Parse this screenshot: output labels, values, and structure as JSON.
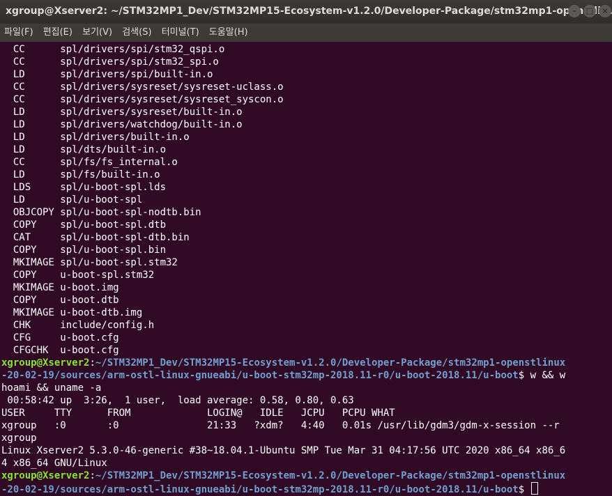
{
  "window": {
    "title": "xgroup@Xserver2: ~/STM32MP1_Dev/STM32MP15-Ecosystem-v1.2.0/Developer-Package/stm32mp1-openstlinux...",
    "minimize_glyph": "–",
    "maximize_glyph": "□",
    "close_glyph": "×"
  },
  "menu": [
    "파일(F)",
    "편집(E)",
    "보기(V)",
    "검색(S)",
    "터미널(T)",
    "도움말(H)"
  ],
  "terminal": {
    "build_lines": [
      "  CC      spl/drivers/spi/stm32_qspi.o",
      "  CC      spl/drivers/spi/stm32_spi.o",
      "  LD      spl/drivers/spi/built-in.o",
      "  CC      spl/drivers/sysreset/sysreset-uclass.o",
      "  CC      spl/drivers/sysreset/sysreset_syscon.o",
      "  LD      spl/drivers/sysreset/built-in.o",
      "  LD      spl/drivers/watchdog/built-in.o",
      "  LD      spl/drivers/built-in.o",
      "  LD      spl/dts/built-in.o",
      "  CC      spl/fs/fs_internal.o",
      "  LD      spl/fs/built-in.o",
      "  LDS     spl/u-boot-spl.lds",
      "  LD      spl/u-boot-spl",
      "  OBJCOPY spl/u-boot-spl-nodtb.bin",
      "  COPY    spl/u-boot-spl.dtb",
      "  CAT     spl/u-boot-spl-dtb.bin",
      "  COPY    spl/u-boot-spl.bin",
      "  MKIMAGE spl/u-boot-spl.stm32",
      "  COPY    u-boot-spl.stm32",
      "  MKIMAGE u-boot.img",
      "  COPY    u-boot.dtb",
      "  MKIMAGE u-boot-dtb.img",
      "  CHK     include/config.h",
      "  CFG     u-boot.cfg",
      "  CFGCHK  u-boot.cfg"
    ],
    "prompt1": {
      "user": "xgroup@Xserver2",
      "sep": ":",
      "path_line1": "~/STM32MP1_Dev/STM32MP15-Ecosystem-v1.2.0/Developer-Package/stm32mp1-openstlinux",
      "path_line2": "-20-02-19/sources/arm-ostl-linux-gnueabi/u-boot-stm32mp-2018.11-r0/u-boot-2018.11/u-boot",
      "dollar": "$",
      "command": " w && w"
    },
    "output_lines": [
      "hoami && uname -a",
      " 00:58:42 up  3:26,  1 user,  load average: 0.58, 0.80, 0.63",
      "USER     TTY      FROM             LOGIN@   IDLE   JCPU   PCPU WHAT",
      "xgroup   :0       :0               21:33   ?xdm?   4:40   0.01s /usr/lib/gdm3/gdm-x-session --r",
      "xgroup",
      "Linux Xserver2 5.3.0-46-generic #38~18.04.1-Ubuntu SMP Tue Mar 31 04:17:56 UTC 2020 x86_64 x86_6",
      "4 x86_64 GNU/Linux"
    ],
    "prompt2": {
      "user": "xgroup@Xserver2",
      "sep": ":",
      "path_line1": "~/STM32MP1_Dev/STM32MP15-Ecosystem-v1.2.0/Developer-Package/stm32mp1-openstlinux",
      "path_line2": "-20-02-19/sources/arm-ostl-linux-gnueabi/u-boot-stm32mp-2018.11-r0/u-boot-2018.11/u-boot",
      "dollar": "$ "
    }
  }
}
